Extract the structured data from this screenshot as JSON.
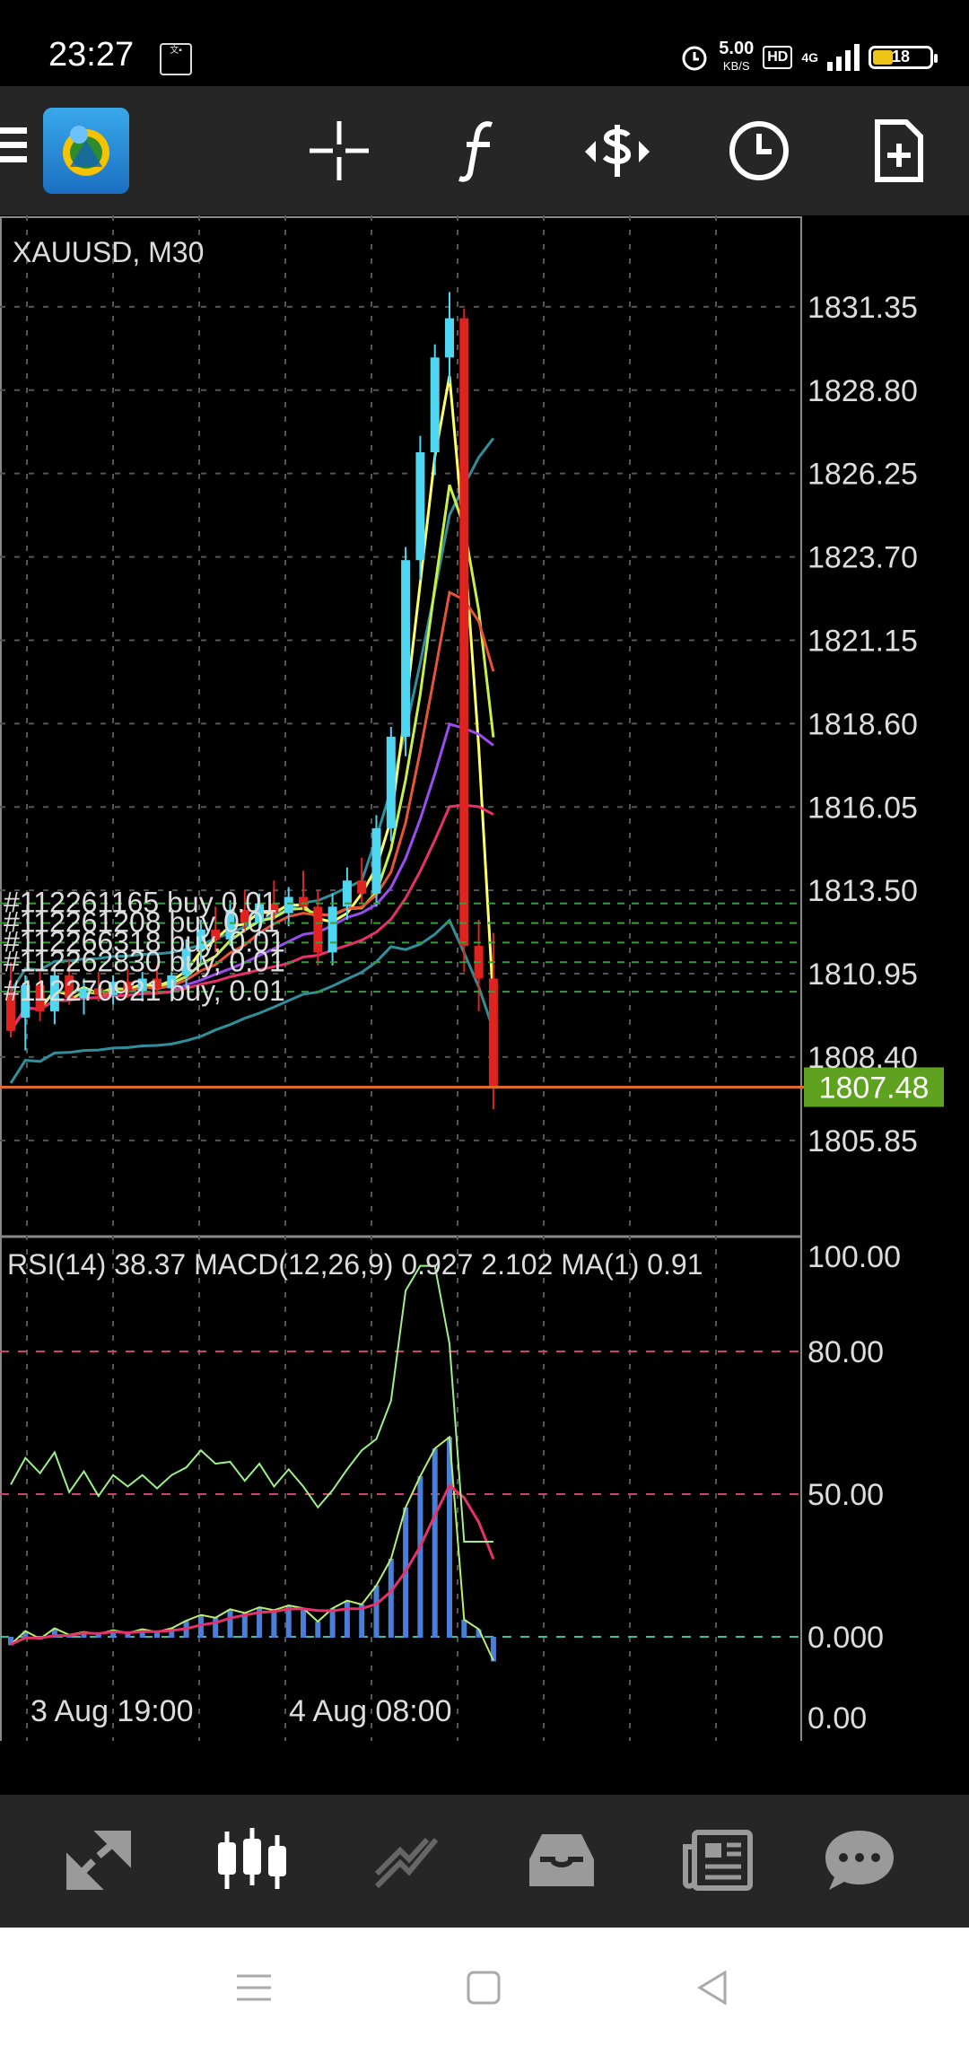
{
  "status_bar": {
    "time": "23:27",
    "speed_value": "5.00",
    "speed_unit": "KB/S",
    "hd": "HD",
    "network": "4G",
    "battery": "18"
  },
  "toolbar": {
    "app_icon": "metatrader-logo",
    "icons": [
      "crosshair-icon",
      "indicator-f-icon",
      "trade-dollar-icon",
      "clock-icon",
      "new-order-icon"
    ]
  },
  "chart": {
    "symbol_label": "XAUUSD, M30",
    "price_axis": [
      "1831.35",
      "1828.80",
      "1826.25",
      "1823.70",
      "1821.15",
      "1818.60",
      "1816.05",
      "1813.50",
      "1810.95",
      "1808.40",
      "1805.85"
    ],
    "current_price": "1807.48",
    "orders": [
      "#112261165 buy 0.01",
      "#112261208 buy 0.01",
      "#112266318 buy, 0.01",
      "#112262830 buy, 0.01",
      "#112270921 buy, 0.01"
    ],
    "indicator_label": "RSI(14) 38.37 MACD(12,26,9) 0.927 2.102 MA(1) 0.91",
    "indicator_axis": [
      "100.00",
      "80.00",
      "50.00",
      "0.000",
      "0.00"
    ],
    "time_axis": [
      "3 Aug 19:00",
      "4 Aug 08:00"
    ],
    "colors": {
      "bull": "#4fd6f0",
      "bear": "#e0231e",
      "current_price": "#63a500"
    }
  },
  "chart_data": {
    "type": "candlestick",
    "title": "XAUUSD, M30",
    "ylim": [
      1804.5,
      1832.5
    ],
    "candles": [
      {
        "o": 1810.4,
        "h": 1811.3,
        "l": 1809.0,
        "c": 1809.2
      },
      {
        "o": 1809.6,
        "h": 1810.9,
        "l": 1808.6,
        "c": 1810.6
      },
      {
        "o": 1810.6,
        "h": 1811.0,
        "l": 1809.5,
        "c": 1809.8
      },
      {
        "o": 1809.8,
        "h": 1811.2,
        "l": 1809.4,
        "c": 1810.9
      },
      {
        "o": 1810.9,
        "h": 1811.4,
        "l": 1810.0,
        "c": 1810.2
      },
      {
        "o": 1810.2,
        "h": 1810.8,
        "l": 1809.7,
        "c": 1810.5
      },
      {
        "o": 1810.5,
        "h": 1811.0,
        "l": 1810.1,
        "c": 1810.3
      },
      {
        "o": 1810.3,
        "h": 1810.9,
        "l": 1810.0,
        "c": 1810.7
      },
      {
        "o": 1810.7,
        "h": 1811.1,
        "l": 1810.2,
        "c": 1810.4
      },
      {
        "o": 1810.4,
        "h": 1811.0,
        "l": 1810.1,
        "c": 1810.8
      },
      {
        "o": 1810.8,
        "h": 1811.2,
        "l": 1810.3,
        "c": 1810.5
      },
      {
        "o": 1810.5,
        "h": 1811.0,
        "l": 1810.1,
        "c": 1810.9
      },
      {
        "o": 1810.9,
        "h": 1812.0,
        "l": 1810.5,
        "c": 1811.7
      },
      {
        "o": 1811.7,
        "h": 1812.6,
        "l": 1811.2,
        "c": 1812.3
      },
      {
        "o": 1812.3,
        "h": 1813.0,
        "l": 1811.6,
        "c": 1812.0
      },
      {
        "o": 1812.0,
        "h": 1813.2,
        "l": 1811.8,
        "c": 1812.9
      },
      {
        "o": 1812.9,
        "h": 1813.5,
        "l": 1812.2,
        "c": 1812.5
      },
      {
        "o": 1812.5,
        "h": 1813.4,
        "l": 1812.1,
        "c": 1813.1
      },
      {
        "o": 1813.1,
        "h": 1813.8,
        "l": 1812.6,
        "c": 1812.8
      },
      {
        "o": 1812.8,
        "h": 1813.6,
        "l": 1812.4,
        "c": 1813.3
      },
      {
        "o": 1813.3,
        "h": 1814.1,
        "l": 1812.9,
        "c": 1813.0
      },
      {
        "o": 1813.0,
        "h": 1813.5,
        "l": 1811.2,
        "c": 1811.6
      },
      {
        "o": 1811.6,
        "h": 1813.4,
        "l": 1811.2,
        "c": 1813.0
      },
      {
        "o": 1813.0,
        "h": 1814.2,
        "l": 1812.6,
        "c": 1813.8
      },
      {
        "o": 1813.8,
        "h": 1814.5,
        "l": 1813.1,
        "c": 1813.4
      },
      {
        "o": 1813.4,
        "h": 1815.8,
        "l": 1813.0,
        "c": 1815.4
      },
      {
        "o": 1815.4,
        "h": 1818.5,
        "l": 1815.0,
        "c": 1818.2
      },
      {
        "o": 1818.2,
        "h": 1824.0,
        "l": 1817.6,
        "c": 1823.6
      },
      {
        "o": 1823.6,
        "h": 1827.4,
        "l": 1823.0,
        "c": 1826.9
      },
      {
        "o": 1826.9,
        "h": 1830.2,
        "l": 1826.2,
        "c": 1829.8
      },
      {
        "o": 1829.8,
        "h": 1831.8,
        "l": 1829.0,
        "c": 1831.0
      },
      {
        "o": 1831.0,
        "h": 1831.3,
        "l": 1811.0,
        "c": 1811.8
      },
      {
        "o": 1811.8,
        "h": 1812.6,
        "l": 1809.8,
        "c": 1810.8
      },
      {
        "o": 1810.8,
        "h": 1812.2,
        "l": 1806.8,
        "c": 1807.5
      }
    ],
    "indicator_ylim": [
      0,
      100
    ]
  }
}
